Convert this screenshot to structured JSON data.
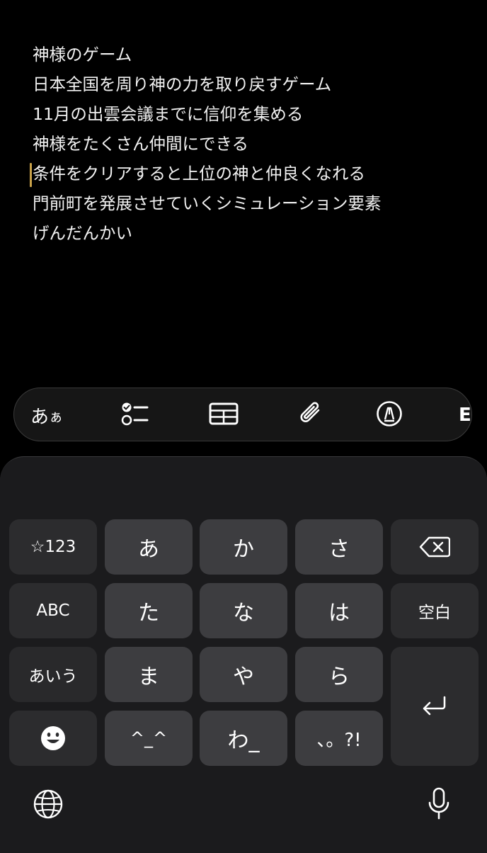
{
  "note": {
    "lines": [
      "神様のゲーム",
      "日本全国を周り神の力を取り戻すゲーム",
      "11月の出雲会議までに信仰を集める",
      "神様をたくさん仲間にできる",
      "条件をクリアすると上位の神と仲良くなれる",
      "門前町を発展させていくシミュレーション要素",
      "げんだんかい"
    ]
  },
  "toolbar": {
    "text_style_label": "あ",
    "text_style_small": "ぁ",
    "icons": [
      "checklist-icon",
      "table-icon",
      "paperclip-icon",
      "pen-circle-icon",
      "more-icon"
    ],
    "cutoff_label": "E"
  },
  "keyboard": {
    "keys": {
      "symbols": "☆123",
      "a": "あ",
      "ka": "か",
      "sa": "さ",
      "abc": "ABC",
      "ta": "た",
      "na": "な",
      "ha": "は",
      "space": "空白",
      "aiu": "あいう",
      "ma": "ま",
      "ya": "や",
      "ra": "ら",
      "kaomoji": "^_^",
      "wa": "わ_",
      "punct": "、。?!"
    },
    "icons": [
      "backspace-icon",
      "return-icon",
      "emoji-icon",
      "globe-icon",
      "microphone-icon"
    ]
  },
  "colors": {
    "background": "#000000",
    "keyboard_bg": "#1b1b1d",
    "key_bg": "#3d3d40",
    "function_key_bg": "#2c2c2e",
    "cursor": "#c9a24a"
  }
}
